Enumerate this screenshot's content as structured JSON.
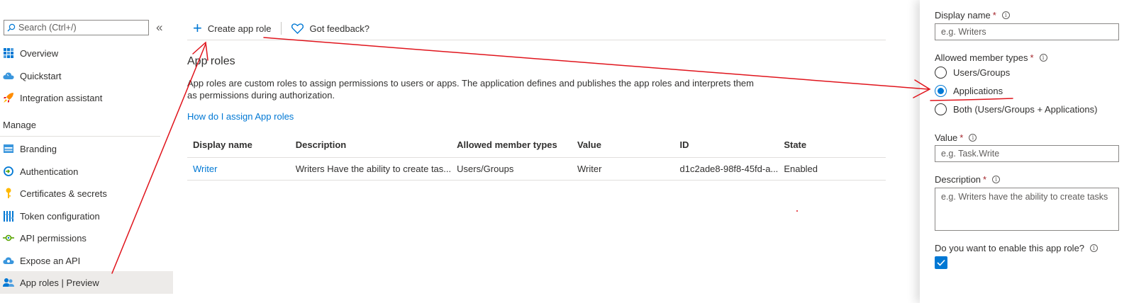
{
  "nav": {
    "search_placeholder": "Search (Ctrl+/)",
    "collapse_label": "«",
    "items_top": [
      {
        "label": "Overview",
        "icon": "grid-icon"
      },
      {
        "label": "Quickstart",
        "icon": "cloud-icon"
      },
      {
        "label": "Integration assistant",
        "icon": "rocket-icon"
      }
    ],
    "manage_heading": "Manage",
    "items_manage": [
      {
        "label": "Branding",
        "icon": "branding-icon"
      },
      {
        "label": "Authentication",
        "icon": "authentication-icon"
      },
      {
        "label": "Certificates & secrets",
        "icon": "key-icon"
      },
      {
        "label": "Token configuration",
        "icon": "token-bars-icon"
      },
      {
        "label": "API permissions",
        "icon": "api-permissions-icon"
      },
      {
        "label": "Expose an API",
        "icon": "cloud-api-icon"
      },
      {
        "label": "App roles | Preview",
        "icon": "users-icon"
      }
    ]
  },
  "toolbar": {
    "create_label": "Create app role",
    "feedback_label": "Got feedback?"
  },
  "main": {
    "title": "App roles",
    "description": "App roles are custom roles to assign permissions to users or apps. The application defines and publishes the app roles and interprets them as permissions during authorization.",
    "help_link": "How do I assign App roles",
    "table": {
      "headers": [
        "Display name",
        "Description",
        "Allowed member types",
        "Value",
        "ID",
        "State"
      ],
      "rows": [
        [
          "Writer",
          "Writers Have the ability to create tas...",
          "Users/Groups",
          "Writer",
          "d1c2ade8-98f8-45fd-a...",
          "Enabled"
        ]
      ]
    }
  },
  "panel": {
    "display_name_label": "Display name",
    "display_name_placeholder": "e.g. Writers",
    "member_types_label": "Allowed member types",
    "member_options": [
      "Users/Groups",
      "Applications",
      "Both (Users/Groups + Applications)"
    ],
    "selected_member_option": "Applications",
    "value_label": "Value",
    "value_placeholder": "e.g. Task.Write",
    "description_label": "Description",
    "description_placeholder": "e.g. Writers have the ability to create tasks",
    "enable_label": "Do you want to enable this app role?",
    "enabled": true,
    "required_mark": "*",
    "info_glyph": "i"
  },
  "colors": {
    "accent": "#0078d4",
    "annotation": "#e0141c",
    "required": "#a4262c"
  }
}
